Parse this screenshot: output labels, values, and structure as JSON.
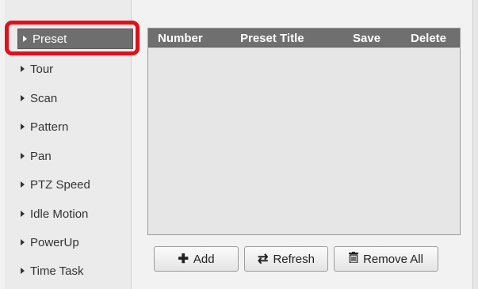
{
  "sidebar": {
    "items": [
      {
        "label": "Preset",
        "active": true
      },
      {
        "label": "Tour"
      },
      {
        "label": "Scan"
      },
      {
        "label": "Pattern"
      },
      {
        "label": "Pan"
      },
      {
        "label": "PTZ Speed"
      },
      {
        "label": "Idle Motion"
      },
      {
        "label": "PowerUp"
      },
      {
        "label": "Time Task"
      }
    ]
  },
  "table": {
    "columns": [
      "Number",
      "Preset Title",
      "Save",
      "Delete"
    ],
    "rows": []
  },
  "buttons": {
    "add": {
      "label": "Add",
      "icon": "plus-icon"
    },
    "refresh": {
      "label": "Refresh",
      "icon": "refresh-icon"
    },
    "remove_all": {
      "label": "Remove All",
      "icon": "trash-icon"
    }
  },
  "colors": {
    "highlight": "#e0101a",
    "active_item": "#6e6e6e",
    "header": "#6f6f6f"
  }
}
